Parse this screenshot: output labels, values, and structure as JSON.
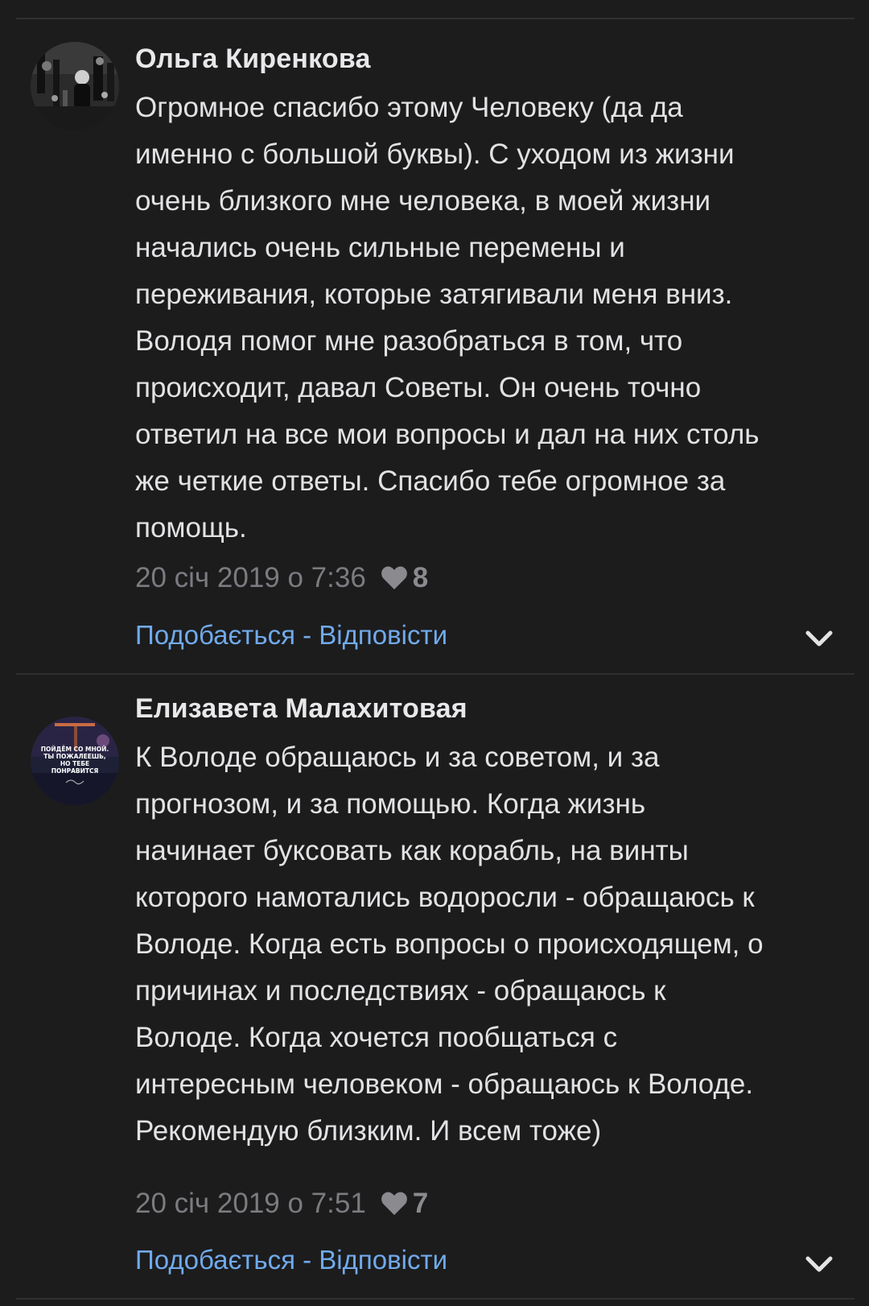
{
  "colors": {
    "background": "#1c1c1d",
    "text": "#e2e2e4",
    "muted": "#7b7b80",
    "link": "#71aaeb",
    "divider": "#2f2f31"
  },
  "comments": [
    {
      "author": "Ольга Киренкова",
      "avatar_icon": "user-avatar-photo",
      "text_lines": [
        "Огромное спасибо этому Человеку (да да",
        "именно с большой буквы). С уходом из жизни",
        "очень близкого мне человека, в моей жизни",
        "начались очень сильные перемены и",
        "переживания, которые затягивали меня вниз.",
        "Володя помог мне разобраться в том, что",
        "происходит, давал Советы. Он очень точно",
        "ответил на все мои вопросы и дал на них столь",
        "же четкие ответы. Спасибо тебе огромное за",
        "помощь."
      ],
      "date": "20 січ 2019 о 7:36",
      "likes": "8",
      "like_label": "Подобається",
      "separator": " - ",
      "reply_label": "Відповісти"
    },
    {
      "author": "Елизавета Малахитовая",
      "avatar_icon": "user-avatar-picture",
      "avatar_text": [
        "ПОЙДЁМ СО МНОЙ.",
        "ТЫ ПОЖАЛЕЕШЬ,",
        "НО ТЕБЕ",
        "ПОНРАВИТСЯ"
      ],
      "text_lines": [
        "К Володе обращаюсь и за советом, и за",
        "прогнозом, и за помощью. Когда жизнь",
        "начинает буксовать как корабль, на винты",
        "которого намотались водоросли - обращаюсь к",
        "Володе. Когда есть вопросы о происходящем, о",
        "причинах и последствиях - обращаюсь к",
        "Володе. Когда хочется пообщаться с",
        "интересным человеком - обращаюсь к Володе.",
        "Рекомендую близким. И всем тоже)"
      ],
      "date": "20 січ 2019 о 7:51",
      "likes": "7",
      "like_label": "Подобається",
      "separator": " - ",
      "reply_label": "Відповісти"
    }
  ]
}
